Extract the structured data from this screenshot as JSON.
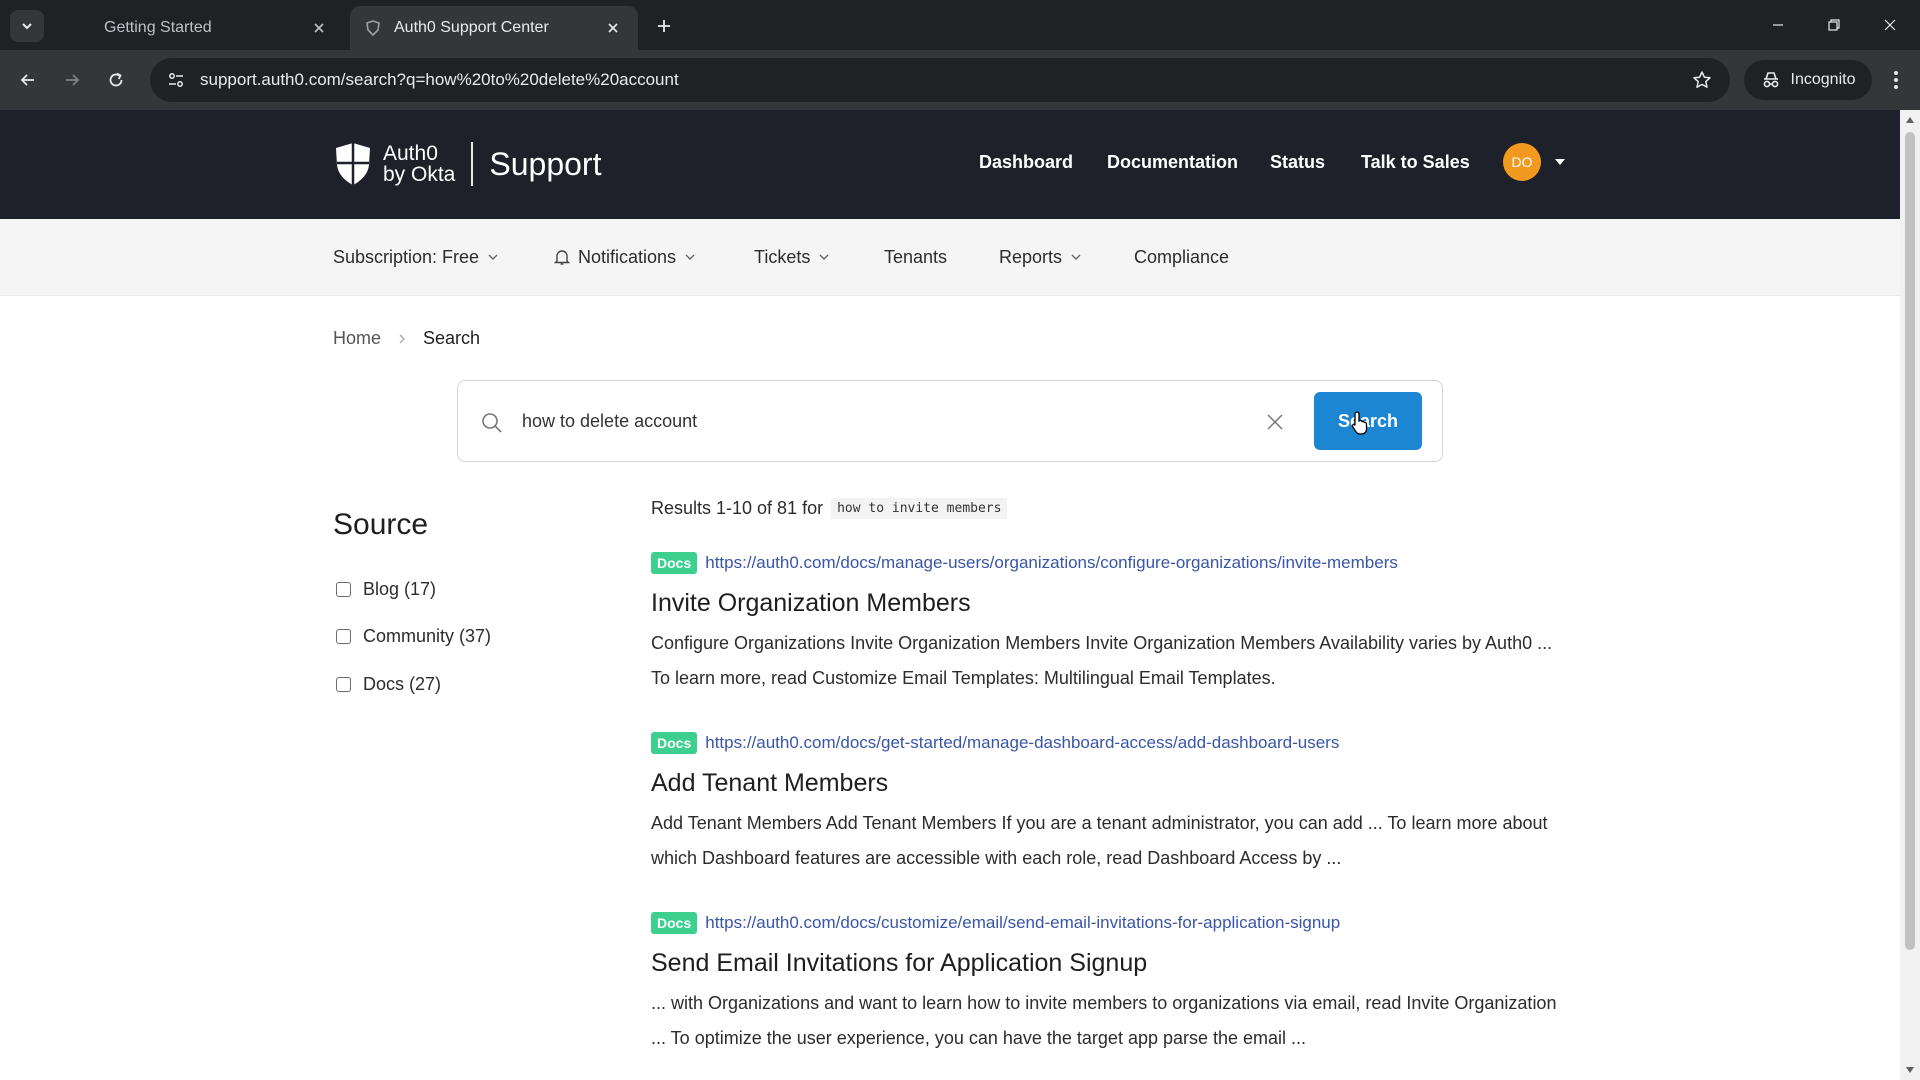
{
  "browser": {
    "tabs": [
      {
        "title": "Getting Started",
        "active": false
      },
      {
        "title": "Auth0 Support Center",
        "active": true
      }
    ],
    "url": "support.auth0.com/search?q=how%20to%20delete%20account",
    "incognito_label": "Incognito"
  },
  "header": {
    "logo_line1": "Auth0",
    "logo_line2": "by Okta",
    "support_label": "Support",
    "nav": [
      "Dashboard",
      "Documentation",
      "Status",
      "Talk to Sales"
    ],
    "avatar_initials": "DO",
    "avatar_color": "#f29a1f"
  },
  "subnav": {
    "subscription": "Subscription: Free",
    "notifications": "Notifications",
    "tickets": "Tickets",
    "tenants": "Tenants",
    "reports": "Reports",
    "compliance": "Compliance"
  },
  "breadcrumb": {
    "home": "Home",
    "current": "Search"
  },
  "search": {
    "value": "how to delete account",
    "button_label": "Search",
    "button_color": "#1d86d3"
  },
  "facets": {
    "title": "Source",
    "items": [
      {
        "label": "Blog (17)",
        "checked": false
      },
      {
        "label": "Community (37)",
        "checked": false
      },
      {
        "label": "Docs (27)",
        "checked": false
      }
    ]
  },
  "results": {
    "summary": "Results 1-10 of 81 for",
    "query": "how to invite members",
    "items": [
      {
        "badge": "Docs",
        "url": "https://auth0.com/docs/manage-users/organizations/configure-organizations/invite-members",
        "title": "Invite Organization Members",
        "snippet": "Configure Organizations Invite Organization Members Invite Organization Members Availability varies by Auth0 ... To learn more, read Customize Email Templates: Multilingual Email Templates."
      },
      {
        "badge": "Docs",
        "url": "https://auth0.com/docs/get-started/manage-dashboard-access/add-dashboard-users",
        "title": "Add Tenant Members",
        "snippet": "Add Tenant Members Add Tenant Members If you are a tenant administrator, you can add ... To learn more about which Dashboard features are accessible with each role, read Dashboard Access by ..."
      },
      {
        "badge": "Docs",
        "url": "https://auth0.com/docs/customize/email/send-email-invitations-for-application-signup",
        "title": "Send Email Invitations for Application Signup",
        "snippet": "... with Organizations and want to learn how to invite members to organizations via email, read Invite Organization ... To optimize the user experience, you can have the target app parse the email ..."
      }
    ],
    "badge_color": "#3ccf8e"
  }
}
